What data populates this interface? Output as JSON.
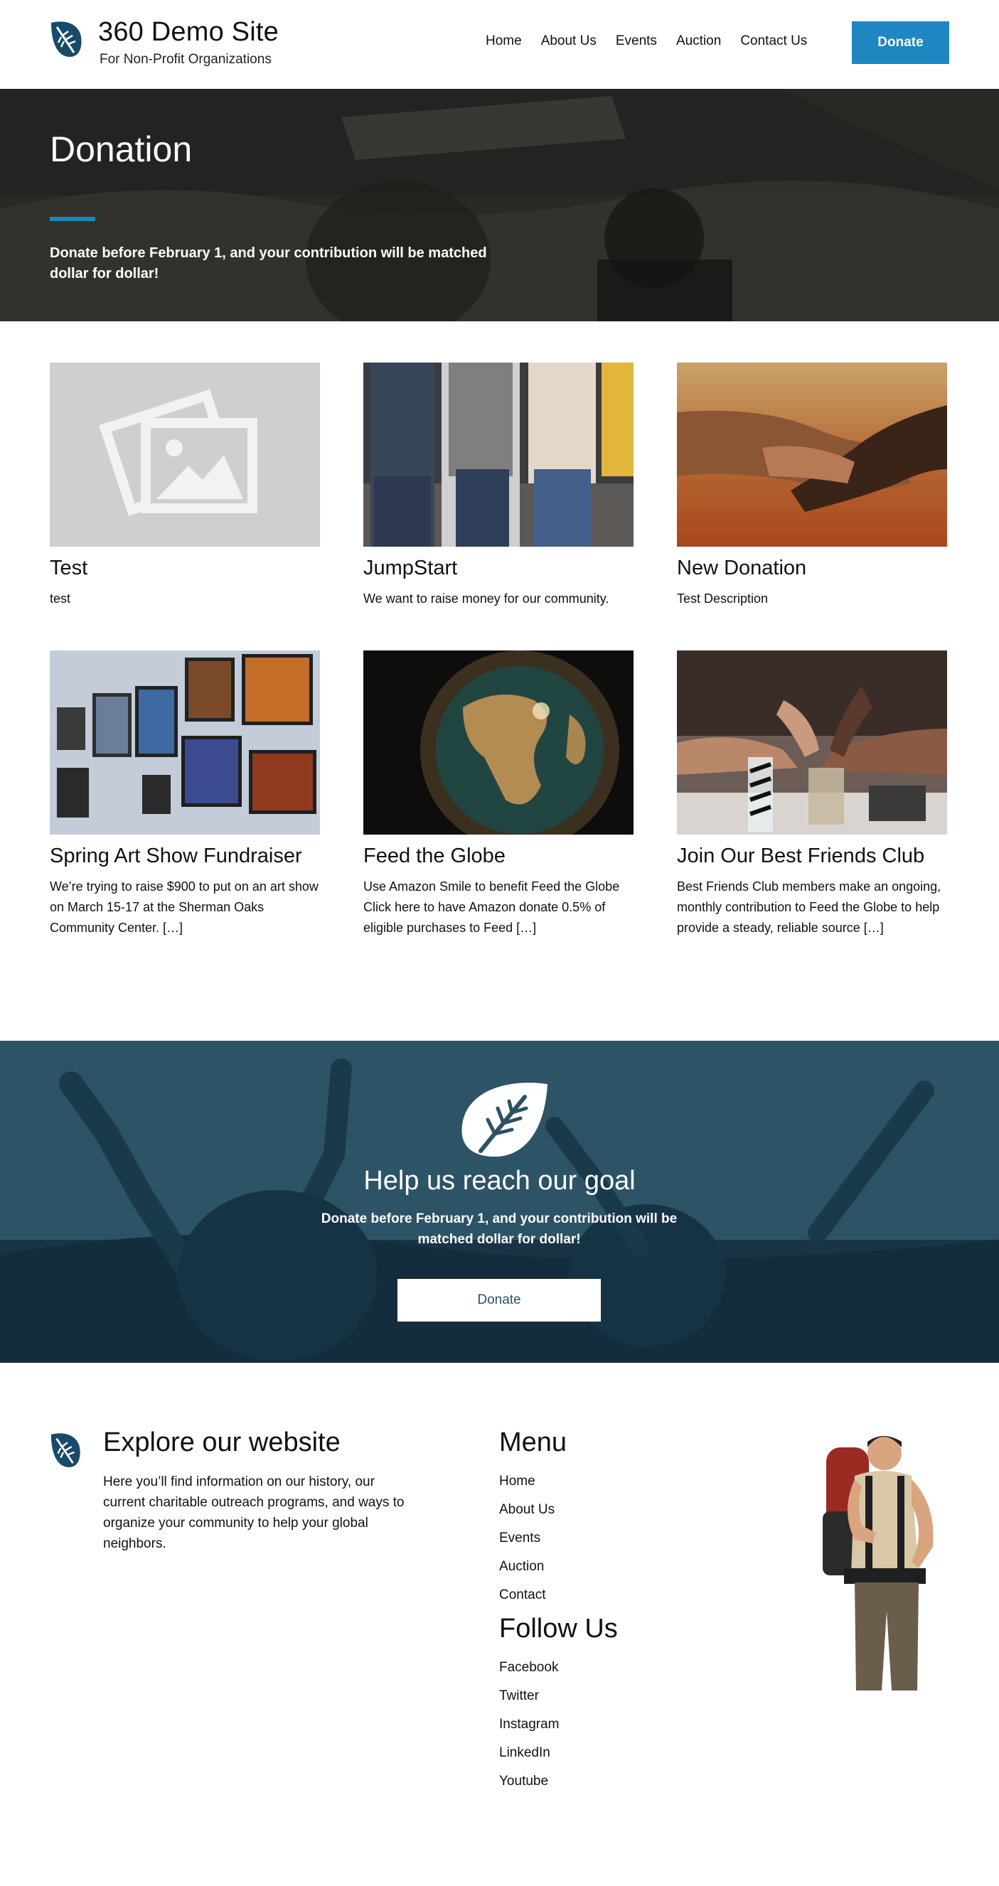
{
  "header": {
    "site_title": "360 Demo Site",
    "tagline": "For Non-Profit Organizations",
    "nav": [
      "Home",
      "About Us",
      "Events",
      "Auction",
      "Contact Us"
    ],
    "donate_label": "Donate",
    "accent_color": "#1e86c1"
  },
  "hero": {
    "title": "Donation",
    "text": "Donate before February 1, and your contribution will be matched dollar for dollar!"
  },
  "cards": [
    {
      "title": "Test",
      "desc": "test",
      "image": "placeholder-image-icon"
    },
    {
      "title": "JumpStart",
      "desc": "We want to raise money for our community.",
      "image": "group-of-people-photo"
    },
    {
      "title": "New Donation",
      "desc": "Test Description",
      "image": "joined-hands-photo"
    },
    {
      "title": "Spring Art Show Fundraiser",
      "desc": "We’re trying to raise $900 to put on an art show on March 15-17 at the Sherman Oaks Community Center. […]",
      "image": "art-gallery-photo"
    },
    {
      "title": "Feed the Globe",
      "desc": "Use Amazon Smile to benefit Feed the Globe Click here to have Amazon donate 0.5% of eligible purchases to Feed […]",
      "image": "globe-photo"
    },
    {
      "title": "Join Our Best Friends Club",
      "desc": "Best Friends Club members make an ongoing, monthly contribution to Feed the Globe to help provide a steady, reliable source […]",
      "image": "fist-bump-photo"
    }
  ],
  "cta": {
    "title": "Help us reach our goal",
    "text": "Donate before February 1, and your contribution will be matched dollar for dollar!",
    "button_label": "Donate",
    "background_color": "#2c5163"
  },
  "footer": {
    "explore_title": "Explore our website",
    "explore_text": "Here you’ll find information on our history, our current charitable outreach programs, and ways to organize your community to help your global neighbors.",
    "menu_heading": "Menu",
    "menu_links": [
      "Home",
      "About Us",
      "Events",
      "Auction",
      "Contact"
    ],
    "follow_heading": "Follow Us",
    "follow_links": [
      "Facebook",
      "Twitter",
      "Instagram",
      "LinkedIn",
      "Youtube"
    ]
  }
}
